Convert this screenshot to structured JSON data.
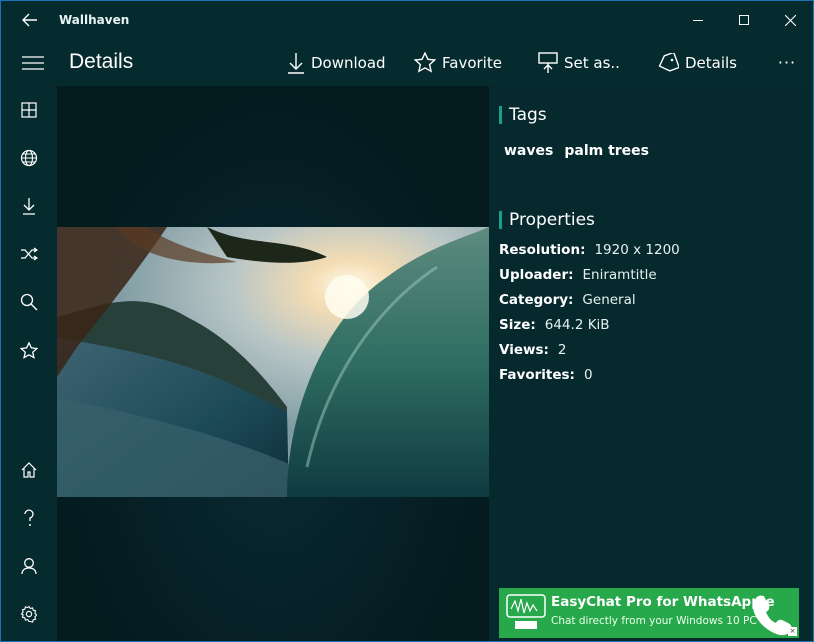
{
  "window": {
    "title": "Wallhaven"
  },
  "header": {
    "page_title": "Details"
  },
  "commands": {
    "download": "Download",
    "favorite": "Favorite",
    "set_as": "Set as..",
    "details": "Details",
    "more": "···"
  },
  "nav": {
    "items": [
      "grid-icon",
      "globe-icon",
      "download-icon",
      "shuffle-icon",
      "search-icon",
      "star-icon"
    ],
    "bottom": [
      "home-icon",
      "help-icon",
      "account-icon",
      "settings-icon"
    ]
  },
  "tags": {
    "title": "Tags",
    "items": [
      "waves",
      "palm trees"
    ]
  },
  "properties": {
    "title": "Properties",
    "rows": [
      {
        "key": "Resolution:",
        "value": "1920 x 1200"
      },
      {
        "key": "Uploader:",
        "value": "Eniramtitle"
      },
      {
        "key": "Category:",
        "value": "General"
      },
      {
        "key": "Size:",
        "value": "644.2 KiB"
      },
      {
        "key": "Views:",
        "value": "2"
      },
      {
        "key": "Favorites:",
        "value": "0"
      }
    ]
  },
  "ad": {
    "title": "EasyChat Pro for WhatsApple",
    "subtitle": "Chat directly from your Windows 10 PC"
  },
  "colors": {
    "accent": "#1aa08a",
    "background": "#062b2f",
    "ad": "#27a84a"
  }
}
